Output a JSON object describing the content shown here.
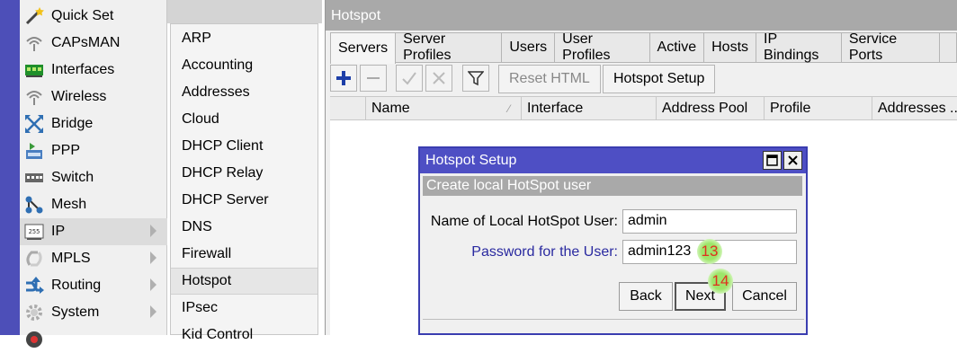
{
  "main_menu": {
    "items": [
      {
        "label": "Quick Set",
        "icon": "wand-icon",
        "arrow": false
      },
      {
        "label": "CAPsMAN",
        "icon": "antenna-icon",
        "arrow": false
      },
      {
        "label": "Interfaces",
        "icon": "interfaces-card-icon",
        "arrow": false
      },
      {
        "label": "Wireless",
        "icon": "wireless-icon",
        "arrow": false
      },
      {
        "label": "Bridge",
        "icon": "bridge-icon",
        "arrow": false
      },
      {
        "label": "PPP",
        "icon": "ppp-icon",
        "arrow": false
      },
      {
        "label": "Switch",
        "icon": "switch-icon",
        "arrow": false
      },
      {
        "label": "Mesh",
        "icon": "mesh-icon",
        "arrow": false
      },
      {
        "label": "IP",
        "icon": "ip-icon",
        "arrow": true,
        "ip_badge": "255"
      },
      {
        "label": "MPLS",
        "icon": "mpls-icon",
        "arrow": true
      },
      {
        "label": "Routing",
        "icon": "routing-icon",
        "arrow": true
      },
      {
        "label": "System",
        "icon": "gear-icon",
        "arrow": true
      }
    ]
  },
  "ip_submenu": {
    "items": [
      "ARP",
      "Accounting",
      "Addresses",
      "Cloud",
      "DHCP Client",
      "DHCP Relay",
      "DHCP Server",
      "DNS",
      "Firewall",
      "Hotspot",
      "IPsec",
      "Kid Control"
    ],
    "selected": "Hotspot"
  },
  "hotspot_window": {
    "title": "Hotspot",
    "tabs": [
      "Servers",
      "Server Profiles",
      "Users",
      "User Profiles",
      "Active",
      "Hosts",
      "IP Bindings",
      "Service Ports"
    ],
    "active_tab": "Servers",
    "toolbar": {
      "reset_html": "Reset HTML",
      "hotspot_setup": "Hotspot Setup"
    },
    "columns": [
      "Name",
      "Interface",
      "Address Pool",
      "Profile",
      "Addresses ..."
    ]
  },
  "dialog": {
    "title": "Hotspot Setup",
    "subtitle": "Create local HotSpot user",
    "fields": {
      "username_label": "Name of Local HotSpot User:",
      "username_value": "admin",
      "password_label": "Password for the User:",
      "password_value": "admin123"
    },
    "buttons": {
      "back": "Back",
      "next": "Next",
      "cancel": "Cancel"
    },
    "step_markers": {
      "password": "13",
      "next": "14"
    }
  },
  "colors": {
    "left_strip": "#4d4fb8",
    "dialog_title_bar": "#4e4fc4",
    "password_label": "#2a2aa0",
    "marker_text": "#e03020"
  }
}
